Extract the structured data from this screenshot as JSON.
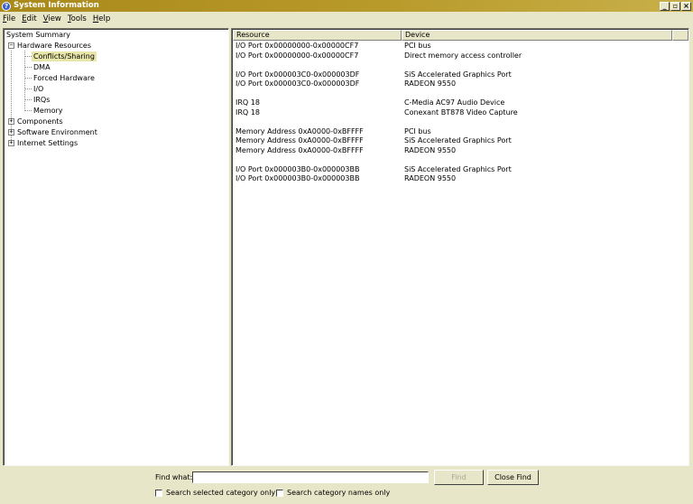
{
  "window": {
    "title": "System Information",
    "minimize_label": "_",
    "maximize_label": "▫",
    "close_label": "×"
  },
  "menu": [
    "File",
    "Edit",
    "View",
    "Tools",
    "Help"
  ],
  "tree": {
    "items": [
      {
        "label": "System Summary"
      },
      {
        "label": "Hardware Resources",
        "expander": "−"
      },
      {
        "label": "Conflicts/Sharing",
        "selected": true
      },
      {
        "label": "DMA"
      },
      {
        "label": "Forced Hardware"
      },
      {
        "label": "I/O"
      },
      {
        "label": "IRQs"
      },
      {
        "label": "Memory"
      },
      {
        "label": "Components",
        "expander": "+"
      },
      {
        "label": "Software Environment",
        "expander": "+"
      },
      {
        "label": "Internet Settings",
        "expander": "+"
      }
    ]
  },
  "list": {
    "columns": [
      "Resource",
      "Device"
    ],
    "groups": [
      [
        [
          "I/O Port 0x00000000-0x00000CF7",
          "PCI bus"
        ],
        [
          "I/O Port 0x00000000-0x00000CF7",
          "Direct memory access controller"
        ]
      ],
      [
        [
          "I/O Port 0x000003C0-0x000003DF",
          "SiS Accelerated Graphics Port"
        ],
        [
          "I/O Port 0x000003C0-0x000003DF",
          "RADEON 9550"
        ]
      ],
      [
        [
          "IRQ 18",
          "C-Media AC97 Audio Device"
        ],
        [
          "IRQ 18",
          "Conexant BT878 Video Capture"
        ]
      ],
      [
        [
          "Memory Address 0xA0000-0xBFFFF",
          "PCI bus"
        ],
        [
          "Memory Address 0xA0000-0xBFFFF",
          "SiS Accelerated Graphics Port"
        ],
        [
          "Memory Address 0xA0000-0xBFFFF",
          "RADEON 9550"
        ]
      ],
      [
        [
          "I/O Port 0x000003B0-0x000003BB",
          "SiS Accelerated Graphics Port"
        ],
        [
          "I/O Port 0x000003B0-0x000003BB",
          "RADEON 9550"
        ]
      ]
    ]
  },
  "find": {
    "label": "Find what:",
    "value": "",
    "find_button": "Find",
    "close_button": "Close Find",
    "search_selected_label": "Search selected category only",
    "search_names_label": "Search category names only"
  }
}
